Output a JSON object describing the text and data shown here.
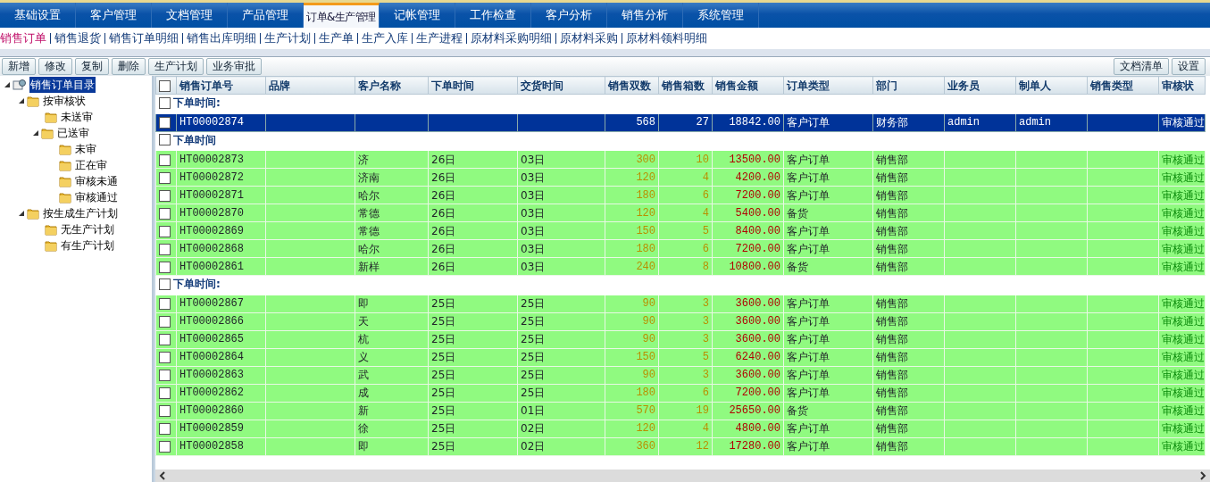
{
  "menu": [
    {
      "label": "基础设置",
      "selected": false
    },
    {
      "label": "客户管理",
      "selected": false
    },
    {
      "label": "文档管理",
      "selected": false
    },
    {
      "label": "产品管理",
      "selected": false
    },
    {
      "label": "订单&生产管理",
      "selected": true
    },
    {
      "label": "记帐管理",
      "selected": false
    },
    {
      "label": "工作检查",
      "selected": false
    },
    {
      "label": "客户分析",
      "selected": false
    },
    {
      "label": "销售分析",
      "selected": false
    },
    {
      "label": "系统管理",
      "selected": false
    }
  ],
  "submenu": [
    {
      "label": "销售订单",
      "selected": true
    },
    {
      "label": "销售退货",
      "selected": false
    },
    {
      "label": "销售订单明细",
      "selected": false
    },
    {
      "label": "销售出库明细",
      "selected": false
    },
    {
      "label": "生产计划",
      "selected": false
    },
    {
      "label": "生产单",
      "selected": false
    },
    {
      "label": "生产入库",
      "selected": false
    },
    {
      "label": "生产进程",
      "selected": false
    },
    {
      "label": "原材料采购明细",
      "selected": false
    },
    {
      "label": "原材料采购",
      "selected": false
    },
    {
      "label": "原材料领料明细",
      "selected": false
    }
  ],
  "toolbar": {
    "left": [
      "新增",
      "修改",
      "复制",
      "删除",
      "生产计划",
      "业务审批"
    ],
    "right": [
      "文档清单",
      "设置"
    ]
  },
  "tree": [
    {
      "label": "销售订单目录",
      "selected": true,
      "expanded": true,
      "children": [
        {
          "label": "按审核状",
          "selected": false,
          "expanded": true,
          "children": [
            {
              "label": "未送审",
              "selected": false
            },
            {
              "label": "已送审",
              "selected": false,
              "expanded": true,
              "children": [
                {
                  "label": "未审",
                  "selected": false
                },
                {
                  "label": "正在审",
                  "selected": false
                },
                {
                  "label": "审核未通",
                  "selected": false
                },
                {
                  "label": "审核通过",
                  "selected": false
                }
              ]
            }
          ]
        },
        {
          "label": "按生成生产计划",
          "selected": false,
          "expanded": true,
          "children": [
            {
              "label": "无生产计划",
              "selected": false
            },
            {
              "label": "有生产计划",
              "selected": false
            }
          ]
        }
      ]
    }
  ],
  "table": {
    "header_checked": false,
    "columns": [
      "销售订单号",
      "品牌",
      "客户名称",
      "下单时间",
      "交货时间",
      "销售双数",
      "销售箱数",
      "销售金额",
      "订单类型",
      "部门",
      "业务员",
      "制单人",
      "销售类型",
      "审核状"
    ],
    "rows": [
      {
        "kind": "group",
        "label": "下单时间:",
        "checked": false
      },
      {
        "kind": "order",
        "checked": false,
        "selected": true,
        "order_no": "HT00002874",
        "pairs": "568",
        "boxes": "27",
        "amount": "18842.00",
        "order_type": "客户订单",
        "dept": "财务部",
        "salesperson": "admin",
        "creator": "admin",
        "status": "审核通过"
      },
      {
        "kind": "group",
        "label": "下单时间",
        "checked": false
      },
      {
        "kind": "order",
        "checked": false,
        "selected": false,
        "order_no": "HT00002873",
        "customer": "济",
        "order_time": "26日",
        "delivery_time": "03日",
        "pairs": "300",
        "boxes": "10",
        "amount": "13500.00",
        "order_type": "客户订单",
        "dept": "销售部",
        "status": "审核通过"
      },
      {
        "kind": "order",
        "checked": false,
        "selected": false,
        "order_no": "HT00002872",
        "customer": "济南",
        "order_time": "26日",
        "delivery_time": "03日",
        "pairs": "120",
        "boxes": "4",
        "amount": "4200.00",
        "order_type": "客户订单",
        "dept": "销售部",
        "status": "审核通过"
      },
      {
        "kind": "order",
        "checked": false,
        "selected": false,
        "order_no": "HT00002871",
        "customer": "哈尔",
        "order_time": "26日",
        "delivery_time": "03日",
        "pairs": "180",
        "boxes": "6",
        "amount": "7200.00",
        "order_type": "客户订单",
        "dept": "销售部",
        "status": "审核通过"
      },
      {
        "kind": "order",
        "checked": false,
        "selected": false,
        "order_no": "HT00002870",
        "customer": "常德",
        "order_time": "26日",
        "delivery_time": "03日",
        "pairs": "120",
        "boxes": "4",
        "amount": "5400.00",
        "order_type": "备货",
        "dept": "销售部",
        "status": "审核通过"
      },
      {
        "kind": "order",
        "checked": false,
        "selected": false,
        "order_no": "HT00002869",
        "customer": "常德",
        "order_time": "26日",
        "delivery_time": "03日",
        "pairs": "150",
        "boxes": "5",
        "amount": "8400.00",
        "order_type": "客户订单",
        "dept": "销售部",
        "status": "审核通过"
      },
      {
        "kind": "order",
        "checked": false,
        "selected": false,
        "order_no": "HT00002868",
        "customer": "哈尔",
        "order_time": "26日",
        "delivery_time": "03日",
        "pairs": "180",
        "boxes": "6",
        "amount": "7200.00",
        "order_type": "客户订单",
        "dept": "销售部",
        "status": "审核通过"
      },
      {
        "kind": "order",
        "checked": false,
        "selected": false,
        "order_no": "HT00002861",
        "customer": "新样",
        "order_time": "26日",
        "delivery_time": "03日",
        "pairs": "240",
        "boxes": "8",
        "amount": "10800.00",
        "order_type": "备货",
        "dept": "销售部",
        "status": "审核通过"
      },
      {
        "kind": "group",
        "label": "下单时间:",
        "checked": false
      },
      {
        "kind": "order",
        "checked": false,
        "selected": false,
        "order_no": "HT00002867",
        "customer": "即",
        "order_time": "25日",
        "delivery_time": "25日",
        "pairs": "90",
        "boxes": "3",
        "amount": "3600.00",
        "order_type": "客户订单",
        "dept": "销售部",
        "status": "审核通过"
      },
      {
        "kind": "order",
        "checked": false,
        "selected": false,
        "order_no": "HT00002866",
        "customer": "天",
        "order_time": "25日",
        "delivery_time": "25日",
        "pairs": "90",
        "boxes": "3",
        "amount": "3600.00",
        "order_type": "客户订单",
        "dept": "销售部",
        "status": "审核通过"
      },
      {
        "kind": "order",
        "checked": false,
        "selected": false,
        "order_no": "HT00002865",
        "customer": "杭",
        "order_time": "25日",
        "delivery_time": "25日",
        "pairs": "90",
        "boxes": "3",
        "amount": "3600.00",
        "order_type": "客户订单",
        "dept": "销售部",
        "status": "审核通过"
      },
      {
        "kind": "order",
        "checked": false,
        "selected": false,
        "order_no": "HT00002864",
        "customer": "义",
        "order_time": "25日",
        "delivery_time": "25日",
        "pairs": "150",
        "boxes": "5",
        "amount": "6240.00",
        "order_type": "客户订单",
        "dept": "销售部",
        "status": "审核通过"
      },
      {
        "kind": "order",
        "checked": false,
        "selected": false,
        "order_no": "HT00002863",
        "customer": "武",
        "order_time": "25日",
        "delivery_time": "25日",
        "pairs": "90",
        "boxes": "3",
        "amount": "3600.00",
        "order_type": "客户订单",
        "dept": "销售部",
        "status": "审核通过"
      },
      {
        "kind": "order",
        "checked": false,
        "selected": false,
        "order_no": "HT00002862",
        "customer": "成",
        "order_time": "25日",
        "delivery_time": "25日",
        "pairs": "180",
        "boxes": "6",
        "amount": "7200.00",
        "order_type": "客户订单",
        "dept": "销售部",
        "status": "审核通过"
      },
      {
        "kind": "order",
        "checked": false,
        "selected": false,
        "order_no": "HT00002860",
        "customer": "新",
        "order_time": "25日",
        "delivery_time": "01日",
        "pairs": "570",
        "boxes": "19",
        "amount": "25650.00",
        "order_type": "备货",
        "dept": "销售部",
        "status": "审核通过"
      },
      {
        "kind": "order",
        "checked": false,
        "selected": false,
        "order_no": "HT00002859",
        "customer": "徐",
        "order_time": "25日",
        "delivery_time": "02日",
        "pairs": "120",
        "boxes": "4",
        "amount": "4800.00",
        "order_type": "客户订单",
        "dept": "销售部",
        "status": "审核通过"
      },
      {
        "kind": "order",
        "checked": false,
        "selected": false,
        "order_no": "HT00002858",
        "customer": "即",
        "order_time": "25日",
        "delivery_time": "02日",
        "pairs": "360",
        "boxes": "12",
        "amount": "17280.00",
        "order_type": "客户订单",
        "dept": "销售部",
        "status": "审核通过"
      }
    ]
  }
}
